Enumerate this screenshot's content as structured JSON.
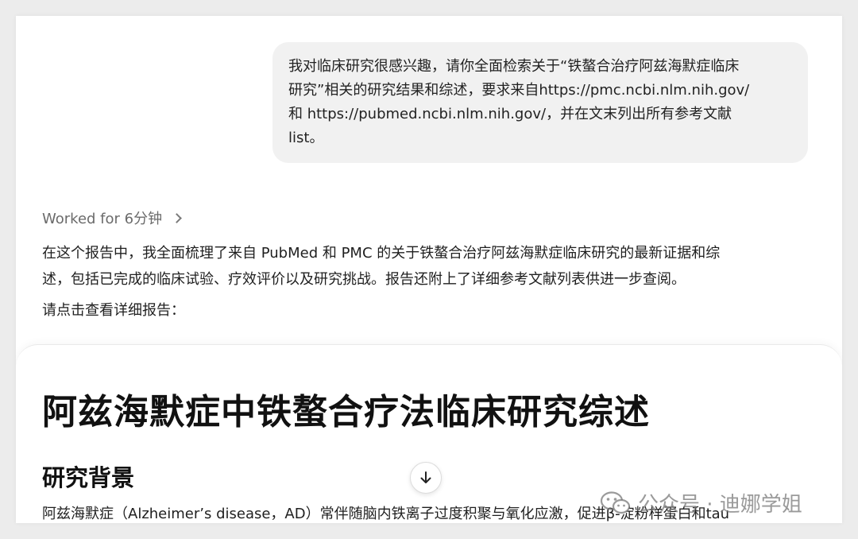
{
  "user_message": {
    "lines": [
      "我对临床研究很感兴趣，请你全面检索关于“铁螯合治疗阿兹海默症临床",
      "研究”相关的研究结果和综述，要求来自https://pmc.ncbi.nlm.nih.gov/",
      "和 https://pubmed.ncbi.nlm.nih.gov/，并在文末列出所有参考文献",
      "list。"
    ]
  },
  "assistant": {
    "worked_for": "Worked for 6分钟",
    "summary_lines": [
      "在这个报告中，我全面梳理了来自 PubMed 和 PMC 的关于铁螯合治疗阿兹海默症临床研究的最新证据和综",
      "述，包括已完成的临床试验、疗效评价以及研究挑战。报告还附上了详细参考文献列表供进一步查阅。"
    ],
    "prompt": "请点击查看详细报告："
  },
  "report": {
    "title": "阿兹海默症中铁螯合疗法临床研究综述",
    "section_heading": "研究背景",
    "section_body": "阿兹海默症（Alzheimer’s disease，AD）常伴随脑内铁离子过度积聚与氧化应激，促进β-淀粉样蛋白和tau"
  },
  "watermark": {
    "text": "公众号 · 迪娜学姐",
    "icon": "wechat-icon"
  },
  "icons": {
    "scroll_down": "arrow-down-icon",
    "worked_for_chevron": "chevron-right-icon"
  }
}
